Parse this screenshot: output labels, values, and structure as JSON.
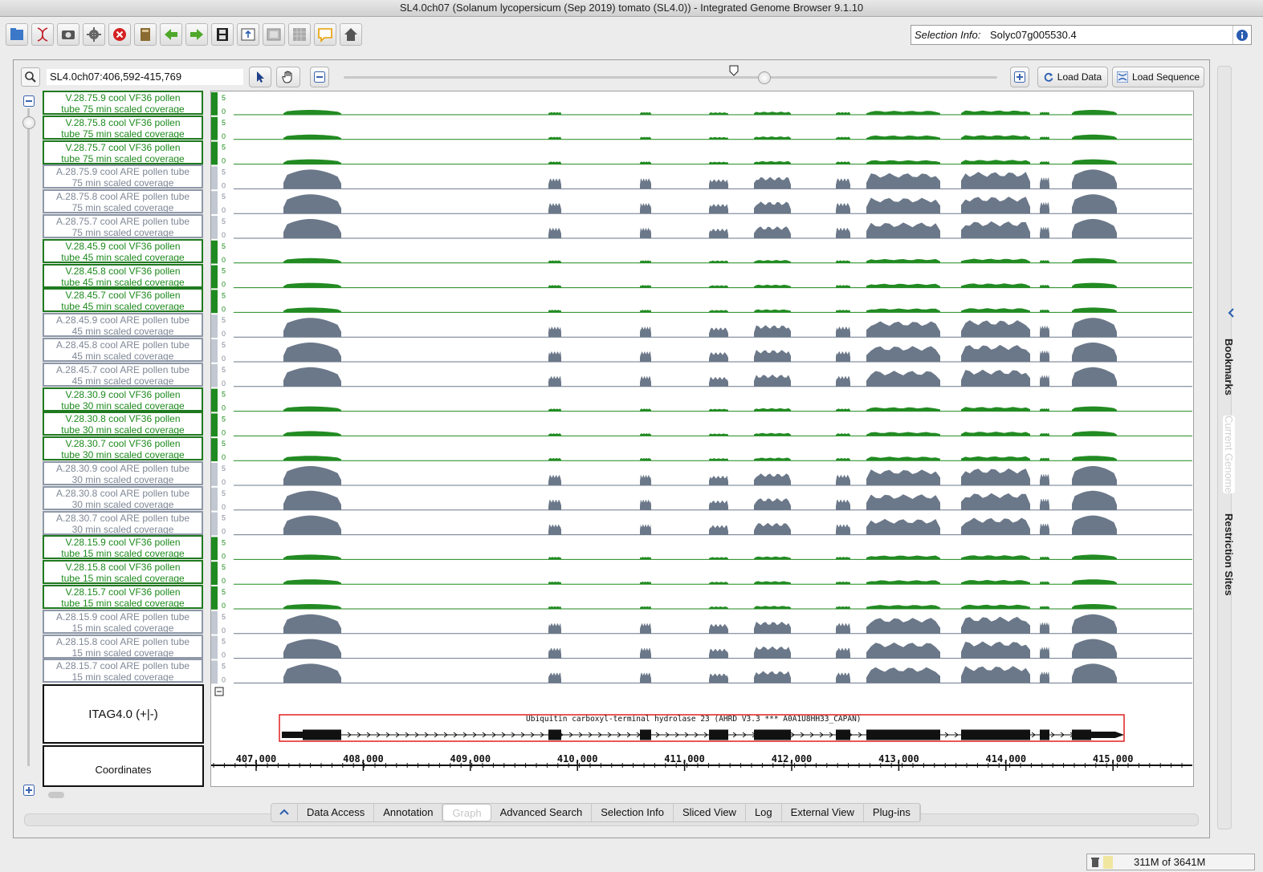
{
  "window": {
    "title": "SL4.0ch07  (Solanum lycopersicum (Sep 2019) tomato (SL4.0)) - Integrated Genome Browser 9.1.10"
  },
  "toolbar": {
    "icons": [
      "open-file-icon",
      "dna-icon",
      "camera-icon",
      "gear-icon",
      "stop-icon",
      "book-icon",
      "arrow-left-icon",
      "arrow-right-icon",
      "film-icon",
      "export-icon",
      "panel-icon",
      "grid-icon",
      "speech-bubble-icon",
      "home-icon"
    ]
  },
  "selection_info": {
    "label": "Selection Info:",
    "value": "Solyc07g005530.4"
  },
  "navbar": {
    "region": "SL4.0ch07:406,592-415,769",
    "load_data": "Load Data",
    "load_sequence": "Load Sequence"
  },
  "tracks": [
    {
      "l1": "V.28.75.9 cool VF36 pollen",
      "l2": "tube 75 min scaled coverage",
      "kind": "green"
    },
    {
      "l1": "V.28.75.8 cool VF36 pollen",
      "l2": "tube 75 min scaled coverage",
      "kind": "green"
    },
    {
      "l1": "V.28.75.7 cool VF36 pollen",
      "l2": "tube 75 min scaled coverage",
      "kind": "green"
    },
    {
      "l1": "A.28.75.9 cool ARE pollen tube",
      "l2": "75 min scaled coverage",
      "kind": "gray"
    },
    {
      "l1": "A.28.75.8 cool ARE pollen tube",
      "l2": "75 min scaled coverage",
      "kind": "gray"
    },
    {
      "l1": "A.28.75.7 cool ARE pollen tube",
      "l2": "75 min scaled coverage",
      "kind": "gray"
    },
    {
      "l1": "V.28.45.9 cool VF36 pollen",
      "l2": "tube 45 min scaled coverage",
      "kind": "green"
    },
    {
      "l1": "V.28.45.8 cool VF36 pollen",
      "l2": "tube 45 min scaled coverage",
      "kind": "green"
    },
    {
      "l1": "V.28.45.7 cool VF36 pollen",
      "l2": "tube 45 min scaled coverage",
      "kind": "green"
    },
    {
      "l1": "A.28.45.9 cool ARE pollen tube",
      "l2": "45 min scaled coverage",
      "kind": "gray"
    },
    {
      "l1": "A.28.45.8 cool ARE pollen tube",
      "l2": "45 min scaled coverage",
      "kind": "gray"
    },
    {
      "l1": "A.28.45.7 cool ARE pollen tube",
      "l2": "45 min scaled coverage",
      "kind": "gray"
    },
    {
      "l1": "V.28.30.9 cool VF36 pollen",
      "l2": "tube 30 min scaled coverage",
      "kind": "green"
    },
    {
      "l1": "V.28.30.8 cool VF36 pollen",
      "l2": "tube 30 min scaled coverage",
      "kind": "green"
    },
    {
      "l1": "V.28.30.7 cool VF36 pollen",
      "l2": "tube 30 min scaled coverage",
      "kind": "green"
    },
    {
      "l1": "A.28.30.9 cool ARE pollen tube",
      "l2": "30 min scaled coverage",
      "kind": "gray"
    },
    {
      "l1": "A.28.30.8 cool ARE pollen tube",
      "l2": "30 min scaled coverage",
      "kind": "gray"
    },
    {
      "l1": "A.28.30.7 cool ARE pollen tube",
      "l2": "30 min scaled coverage",
      "kind": "gray"
    },
    {
      "l1": "V.28.15.9 cool VF36 pollen",
      "l2": "tube 15 min scaled coverage",
      "kind": "green"
    },
    {
      "l1": "V.28.15.8 cool VF36 pollen",
      "l2": "tube 15 min scaled coverage",
      "kind": "green"
    },
    {
      "l1": "V.28.15.7 cool VF36 pollen",
      "l2": "tube 15 min scaled coverage",
      "kind": "green"
    },
    {
      "l1": "A.28.15.9 cool ARE pollen tube",
      "l2": "15 min scaled coverage",
      "kind": "gray"
    },
    {
      "l1": "A.28.15.8 cool ARE pollen tube",
      "l2": "15 min scaled coverage",
      "kind": "gray"
    },
    {
      "l1": "A.28.15.7 cool ARE pollen tube",
      "l2": "15 min scaled coverage",
      "kind": "gray"
    }
  ],
  "axis_tick_labels": [
    "5",
    "0"
  ],
  "gene_track": {
    "label": "ITAG4.0 (+|-)",
    "gene_name": "Ubiquitin carboxyl-terminal hydrolase 23 (AHRD V3.3 *** A0A1U8HH33_CAPAN)"
  },
  "coordinates": {
    "label": "Coordinates",
    "ticks": [
      "407,000",
      "408,000",
      "409,000",
      "410,000",
      "411,000",
      "412,000",
      "413,000",
      "414,000",
      "415,000"
    ]
  },
  "tabs": [
    "Data Access",
    "Annotation",
    "Graph",
    "Advanced Search",
    "Selection Info",
    "Sliced View",
    "Log",
    "External View",
    "Plug-ins"
  ],
  "active_tab": "Graph",
  "side_tabs": {
    "bookmarks": "Bookmarks",
    "current_genome": "Current Genome",
    "restriction_sites": "Restriction Sites"
  },
  "status": {
    "memory": "311M of 3641M"
  },
  "colors": {
    "green_track": "#228b22",
    "gray_track": "#6b7889",
    "gene_box": "#e02020"
  }
}
